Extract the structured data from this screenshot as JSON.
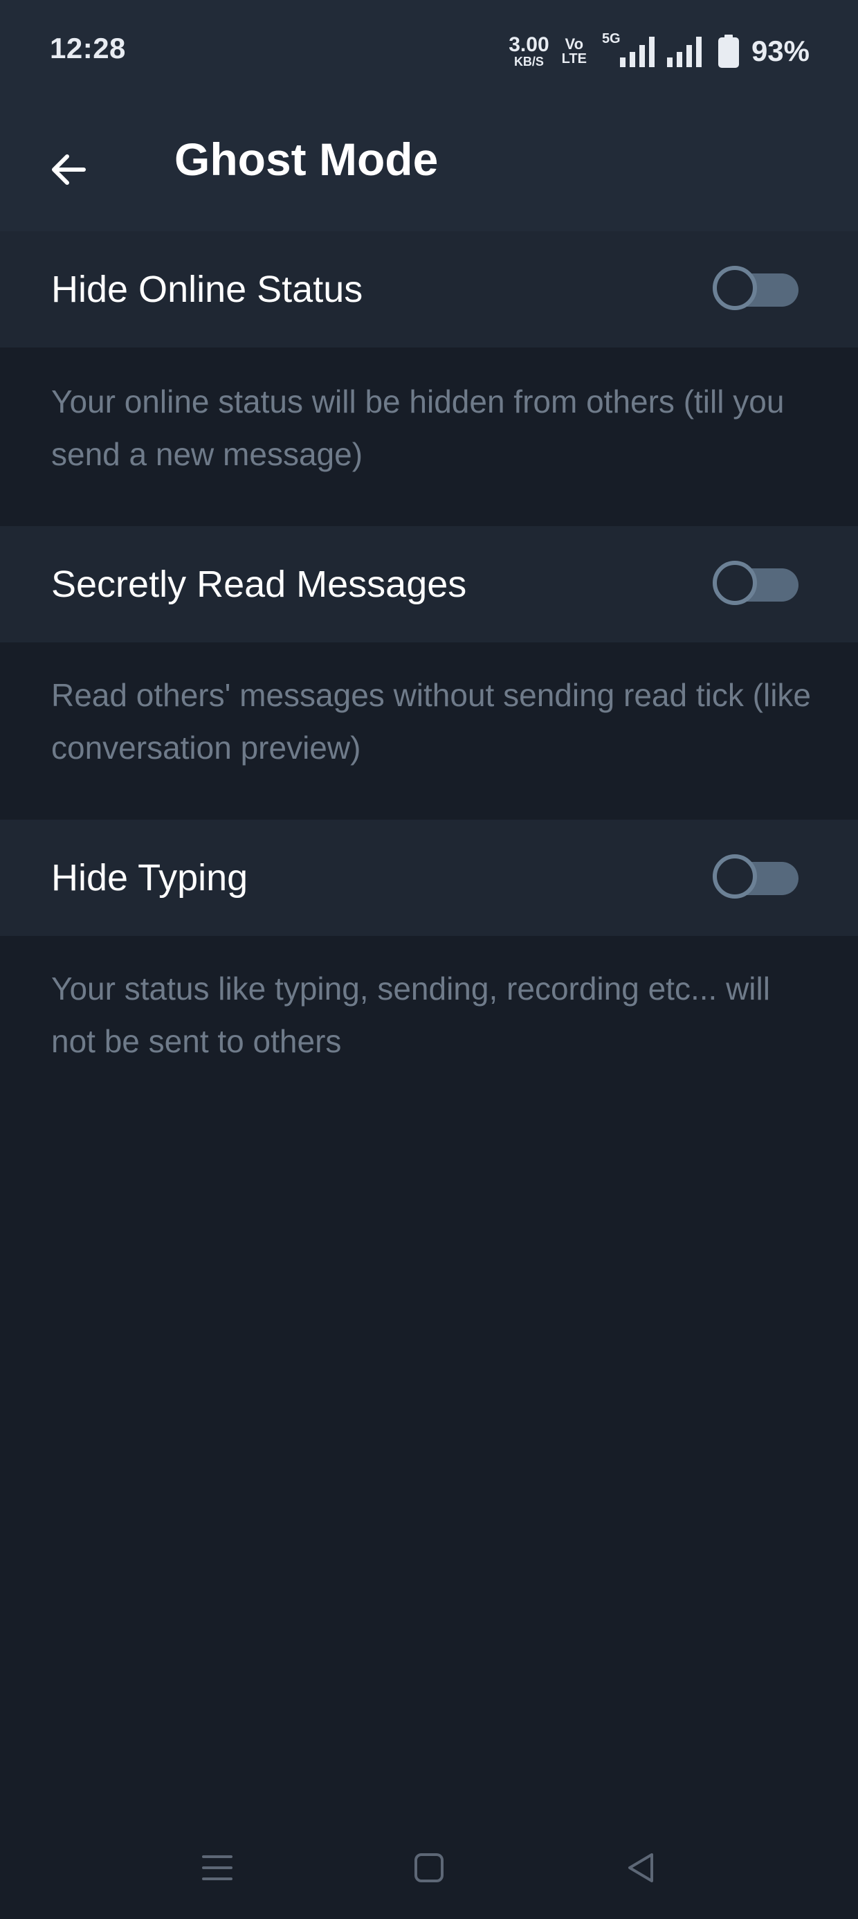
{
  "status_bar": {
    "time": "12:28",
    "net_speed_value": "3.00",
    "net_speed_unit": "KB/S",
    "volte_top": "Vo",
    "volte_bottom": "LTE",
    "network_type": "5G",
    "battery_percent": "93%"
  },
  "app_bar": {
    "title": "Ghost Mode"
  },
  "settings": [
    {
      "label": "Hide Online Status",
      "enabled": false,
      "description": "Your online status will be hidden from others (till you send a new message)"
    },
    {
      "label": "Secretly Read Messages",
      "enabled": false,
      "description": "Read others' messages without sending read tick (like conversation preview)"
    },
    {
      "label": "Hide Typing",
      "enabled": false,
      "description": "Your status like typing, sending, recording etc... will not be sent to others"
    }
  ],
  "colors": {
    "background": "#171d27",
    "header": "#222b38",
    "row": "#1f2733",
    "description_text": "#6f7b8a",
    "toggle_track_off": "#56697d"
  },
  "nav_bar": {
    "icons": [
      "menu-icon",
      "home-icon",
      "back-icon"
    ]
  }
}
